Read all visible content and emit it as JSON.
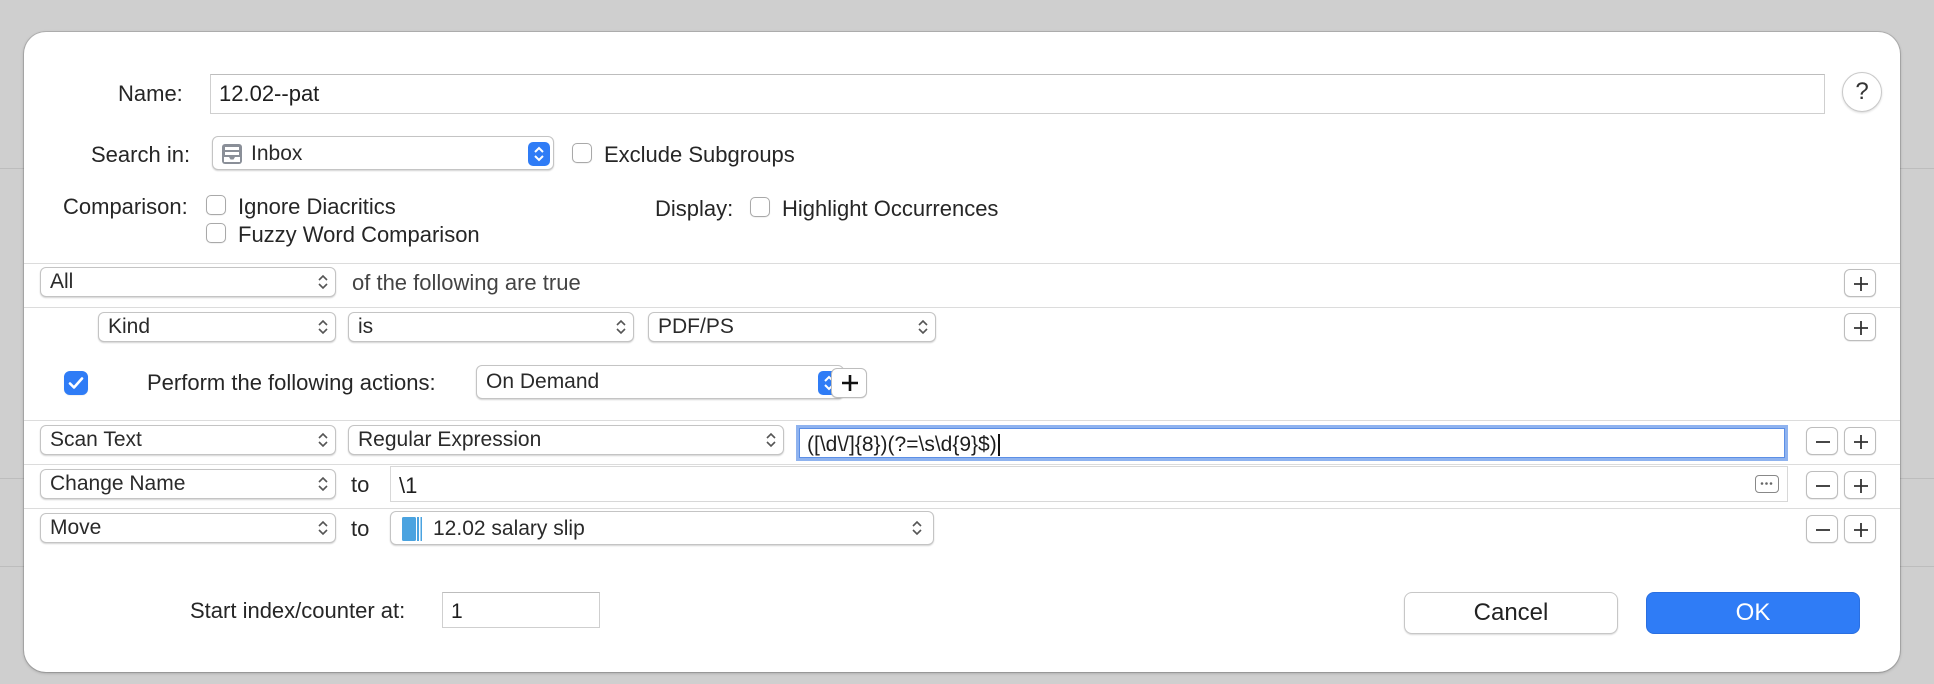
{
  "form": {
    "name_label": "Name:",
    "name_value": "12.02--pat",
    "search_in_label": "Search in:",
    "search_in_value": "Inbox",
    "exclude_subgroups_label": "Exclude Subgroups",
    "exclude_subgroups_checked": false,
    "comparison_label": "Comparison:",
    "ignore_diacritics_label": "Ignore Diacritics",
    "fuzzy_word_label": "Fuzzy Word Comparison",
    "display_label": "Display:",
    "highlight_label": "Highlight Occurrences",
    "help_label": "?"
  },
  "conditions": {
    "match_value": "All",
    "match_suffix": "of the following are true",
    "rule": {
      "field": "Kind",
      "operator": "is",
      "value": "PDF/PS"
    }
  },
  "actions": {
    "enabled": true,
    "label": "Perform the following actions:",
    "trigger": "On Demand",
    "rows": [
      {
        "action": "Scan Text",
        "mode": "Regular Expression",
        "value": "([\\d\\/]{8})(?=\\s\\d{9}$)"
      },
      {
        "action": "Change Name",
        "to_label": "to",
        "value": "\\1"
      },
      {
        "action": "Move",
        "to_label": "to",
        "value": "12.02 salary slip"
      }
    ]
  },
  "footer": {
    "counter_label": "Start index/counter at:",
    "counter_value": "1",
    "cancel_label": "Cancel",
    "ok_label": "OK"
  },
  "colors": {
    "accent": "#2f7cf6",
    "focus_ring": "#8fb3ef"
  }
}
